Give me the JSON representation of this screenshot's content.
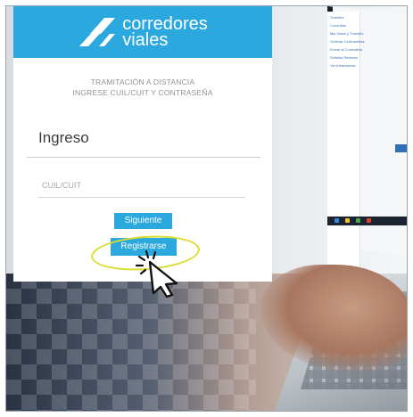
{
  "brand": {
    "line1": "corredores",
    "line2": "viales"
  },
  "card": {
    "subtitle_line1": "TRAMITACIÓN A DISTANCIA",
    "subtitle_line2": "INGRESE CUIL/CUIT Y CONTRASEÑA",
    "heading": "Ingreso",
    "cuil_placeholder": "CUIL/CUIT",
    "next_button": "Siguiente",
    "register_button": "Registrarse"
  },
  "colors": {
    "brand_blue": "#2ba9df",
    "highlight": "#d9dd2c"
  },
  "laptop_sidebar": [
    "Tramites",
    "Consultas",
    "Mis Datos y Tramites",
    "Ordenar Contraseñas",
    "Enviar al Contratista",
    "Solicitar Reclamo",
    "Ver Infracciones"
  ]
}
